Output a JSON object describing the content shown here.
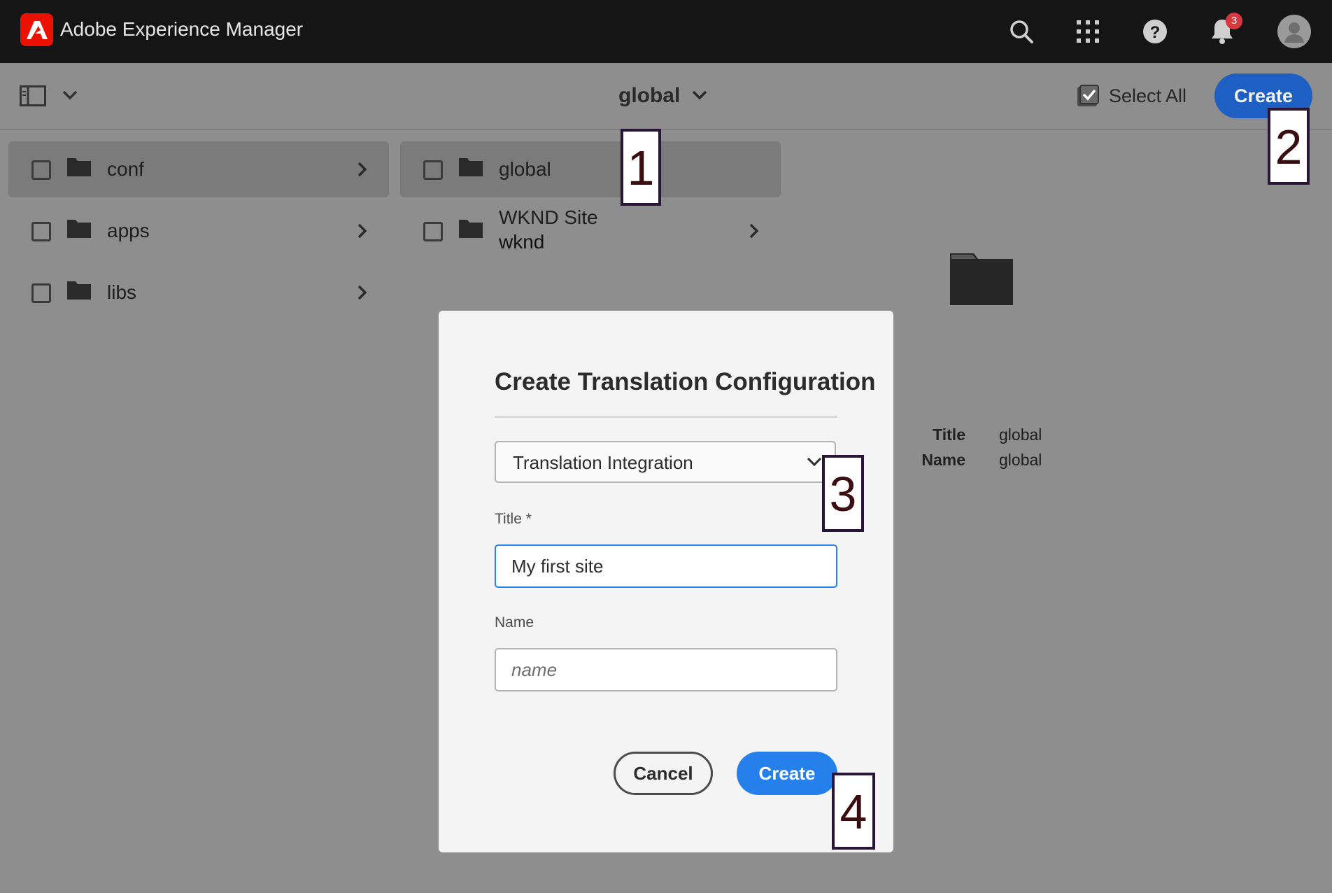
{
  "app": {
    "title": "Adobe Experience Manager"
  },
  "header": {
    "notifications_count": "3",
    "icons": [
      "search-icon",
      "apps-grid-icon",
      "help-icon",
      "bell-icon",
      "user-avatar-icon"
    ]
  },
  "toolbar": {
    "current_folder": "global",
    "select_all_label": "Select All",
    "create_label": "Create"
  },
  "columns": [
    {
      "items": [
        {
          "label": "conf",
          "selected": true,
          "has_children": true
        },
        {
          "label": "apps",
          "selected": false,
          "has_children": true
        },
        {
          "label": "libs",
          "selected": false,
          "has_children": true
        }
      ]
    },
    {
      "items": [
        {
          "label": "global",
          "selected": true,
          "has_children": false
        },
        {
          "label": "WKND Site",
          "sublabel": "wknd",
          "selected": false,
          "has_children": true
        }
      ]
    }
  ],
  "preview": {
    "title_key": "Title",
    "title_value": "global",
    "name_key": "Name",
    "name_value": "global"
  },
  "dialog": {
    "title": "Create Translation Configuration",
    "type_select_value": "Translation Integration",
    "title_field_label": "Title *",
    "title_field_value": "My first site",
    "name_field_label": "Name",
    "name_field_placeholder": "name",
    "cancel_label": "Cancel",
    "create_label": "Create"
  },
  "callouts": [
    "1",
    "2",
    "3",
    "4"
  ],
  "colors": {
    "topbar": "#151515",
    "accent": "#2680eb",
    "brand": "#eb1000",
    "overlay": "#8e8e8e"
  }
}
